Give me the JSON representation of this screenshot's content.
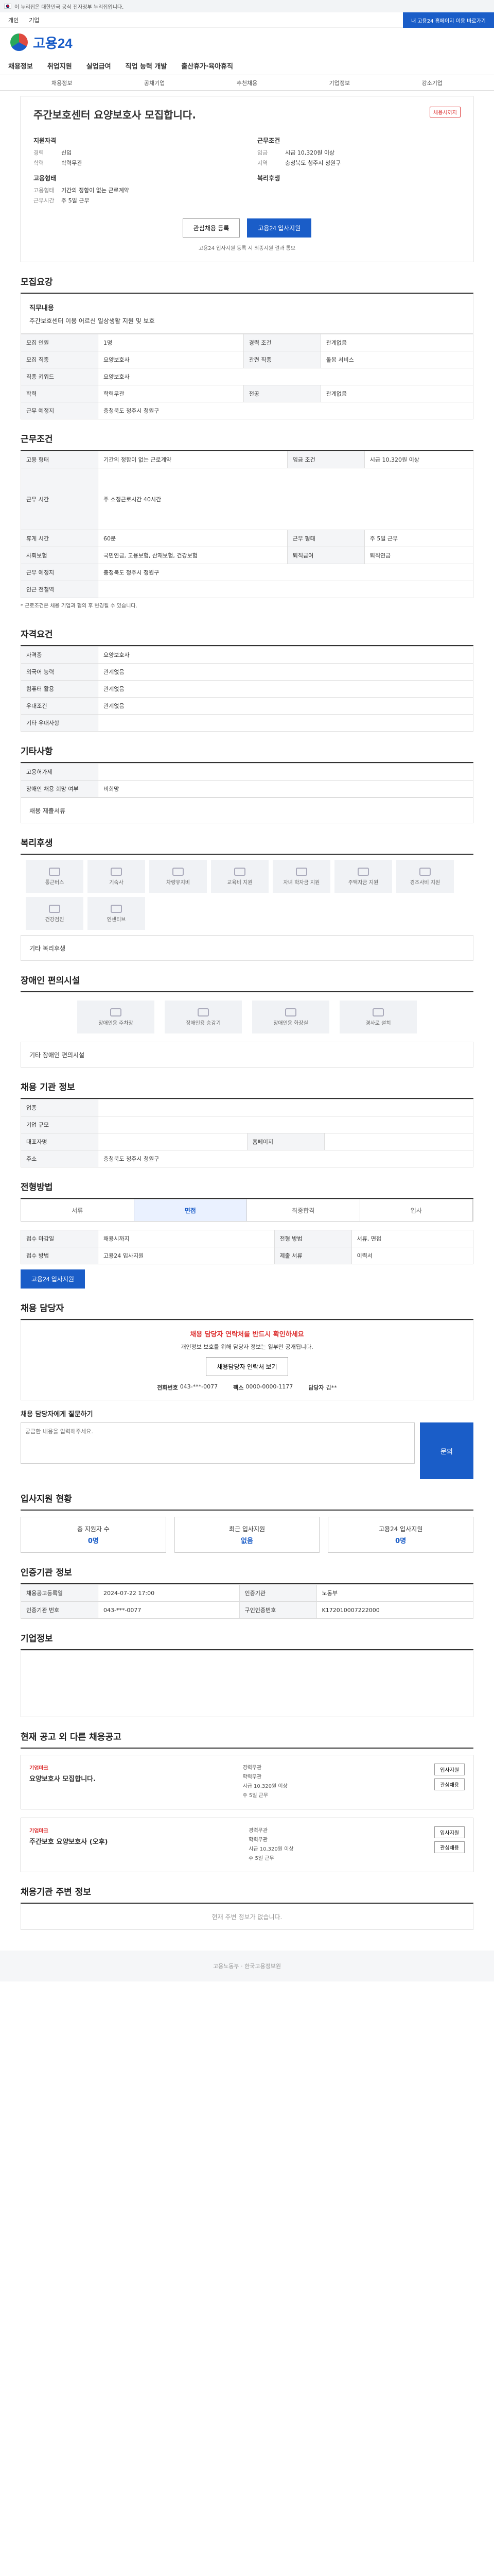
{
  "gov_banner": "이 누리집은 대한민국 공식 전자정부 누리집입니다.",
  "top": {
    "left": [
      "개인",
      "기업"
    ],
    "right": "내 고용24 홈페이지 이용 바로가기"
  },
  "logo": "고용24",
  "gnb": [
    "채용정보",
    "취업지원",
    "실업급여",
    "직업 능력 개발",
    "출산휴가·육아휴직"
  ],
  "subnav": [
    "채용정보",
    "공채기업",
    "추천채용",
    "기업정보",
    "강소기업"
  ],
  "job": {
    "title": "주간보호센터 요양보호사 모집합니다.",
    "badge": "채용시까지",
    "left_title": "지원자격",
    "right_title": "근무조건",
    "rows_left": [
      [
        "경력",
        "신입"
      ],
      [
        "학력",
        "학력무관"
      ]
    ],
    "rows_right": [
      [
        "임금",
        "시급 10,320원 이상"
      ],
      [
        "지역",
        "충청북도 청주시 청원구"
      ]
    ],
    "apply_title": "고용형태",
    "apply_rows": [
      [
        "고용형태",
        "기간의 정함이 없는 근로계약"
      ],
      [
        "근무시간",
        "주 5일 근무"
      ]
    ],
    "extra_title": "복리후생",
    "btn_interest": "관심채용 등록",
    "btn_apply": "고용24 입사지원",
    "notice": "고용24 입사지원 등록 시 최종지원 결과 통보"
  },
  "recruit": {
    "title": "모집요강",
    "duty_label": "직무내용",
    "duty": "주간보호센터 이용 어르신 일상생활 지원 및 보호",
    "rows": [
      [
        "모집 인원",
        "1명",
        "경력 조건",
        "관계없음"
      ],
      [
        "모집 직종",
        "요양보호사",
        "관련 직종",
        "돌봄 서비스"
      ],
      [
        "직종 키워드",
        "요양보호사",
        "",
        ""
      ],
      [
        "학력",
        "학력무관",
        "전공",
        "관계없음"
      ],
      [
        "근무 예정지",
        "충청북도 청주시 청원구",
        "",
        ""
      ]
    ]
  },
  "work": {
    "title": "근무조건",
    "rows": [
      [
        "고용 형태",
        "기간의 정함이 없는 근로계약",
        "임금 조건",
        "시급 10,320원 이상"
      ],
      [
        "근무 시간",
        "주 소정근로시간 40시간",
        "",
        ""
      ],
      [
        "휴게 시간",
        "60분",
        "근무 형태",
        "주 5일 근무"
      ],
      [
        "사회보험",
        "국민연금, 고용보험, 산재보험, 건강보험",
        "퇴직급여",
        "퇴직연금"
      ],
      [
        "근무 예정지",
        "충청북도 청주시 청원구",
        "",
        ""
      ],
      [
        "인근 전철역",
        "",
        "",
        ""
      ]
    ],
    "note": "* 근로조건은 채용 기업과 협의 후 변경될 수 있습니다."
  },
  "qual": {
    "title": "자격요건",
    "rows": [
      [
        "자격증",
        "요양보호사"
      ],
      [
        "외국어 능력",
        "관계없음"
      ],
      [
        "컴퓨터 활용",
        "관계없음"
      ],
      [
        "우대조건",
        "관계없음"
      ],
      [
        "기타 우대사항",
        ""
      ]
    ]
  },
  "etc": {
    "title": "기타사항",
    "rows": [
      [
        "고용허가제",
        ""
      ],
      [
        "장애인 채용 희망 여부",
        "비희망"
      ]
    ],
    "sub": "채용 제출서류"
  },
  "welfare": {
    "title": "복리후생",
    "items": [
      "통근버스",
      "기숙사",
      "차량유지비",
      "교육비 지원",
      "자녀 학자금 지원",
      "주택자금 지원",
      "경조사비 지원",
      "건강검진",
      "인센티브"
    ],
    "sub": "기타 복리후생"
  },
  "disabled": {
    "title": "장애인 편의시설",
    "items": [
      "장애인용 주차장",
      "장애인용 승강기",
      "장애인용 화장실",
      "경사로 설치"
    ],
    "sub": "기타 장애인 편의시설"
  },
  "company": {
    "title": "채용 기관 정보",
    "rows": [
      [
        "업종",
        "",
        "",
        ""
      ],
      [
        "기업 규모",
        "",
        "",
        ""
      ],
      [
        "대표자명",
        "",
        "홈페이지",
        ""
      ],
      [
        "주소",
        "충청북도 청주시 청원구",
        "",
        ""
      ]
    ]
  },
  "process": {
    "title": "전형방법",
    "steps": [
      "서류",
      "면접",
      "최종합격",
      "입사"
    ],
    "rows": [
      [
        "접수 마감일",
        "채용시까지",
        "전형 방법",
        "서류, 면접"
      ],
      [
        "접수 방법",
        "고용24 입사지원",
        "제출 서류",
        "이력서"
      ]
    ],
    "btn": "고용24 입사지원"
  },
  "inquiry": {
    "title": "채용 담당자",
    "alert": "채용 담당자 연락처를 반드시 확인하세요",
    "desc": "개인정보 보호를 위해 담당자 정보는 일부만 공개됩니다.",
    "btn": "채용담당자 연락처 보기",
    "contacts": [
      [
        "전화번호",
        "043-***-0077"
      ],
      [
        "팩스",
        "0000-0000-1177"
      ],
      [
        "담당자",
        "김**"
      ]
    ],
    "q_label": "채용 담당자에게 질문하기",
    "q_placeholder": "궁금한 내용을 입력해주세요.",
    "send": "문의"
  },
  "status": {
    "title": "입사지원 현황",
    "items": [
      [
        "총 지원자 수",
        "0명"
      ],
      [
        "최근 입사지원",
        "없음"
      ],
      [
        "고용24 입사지원",
        "0명"
      ]
    ]
  },
  "info": {
    "title": "인증기관 정보",
    "rows": [
      [
        "채용공고등록일",
        "2024-07-22 17:00",
        "인증기관",
        "노동부"
      ],
      [
        "인증기관 번호",
        "043-***-0077",
        "구인인증번호",
        "K172010007222000"
      ]
    ]
  },
  "corp": {
    "title": "기업정보"
  },
  "related": {
    "title": "현재 공고 외 다른 채용공고",
    "items": [
      {
        "comp": "기업마크",
        "title": "요양보호사 모집합니다.",
        "meta": [
          "경력무관",
          "학력무관",
          "시급 10,320원 이상",
          "주 5일 근무"
        ],
        "acts": [
          "입사지원",
          "관심채용"
        ]
      },
      {
        "comp": "기업마크",
        "title": "주간보호 요양보호사 (오후)",
        "meta": [
          "경력무관",
          "학력무관",
          "시급 10,320원 이상",
          "주 5일 근무"
        ],
        "acts": [
          "입사지원",
          "관심채용"
        ]
      }
    ]
  },
  "nearby": {
    "title": "채용기관 주변 정보",
    "empty": "현재 주변 정보가 없습니다."
  },
  "footer": "고용노동부 · 한국고용정보원"
}
